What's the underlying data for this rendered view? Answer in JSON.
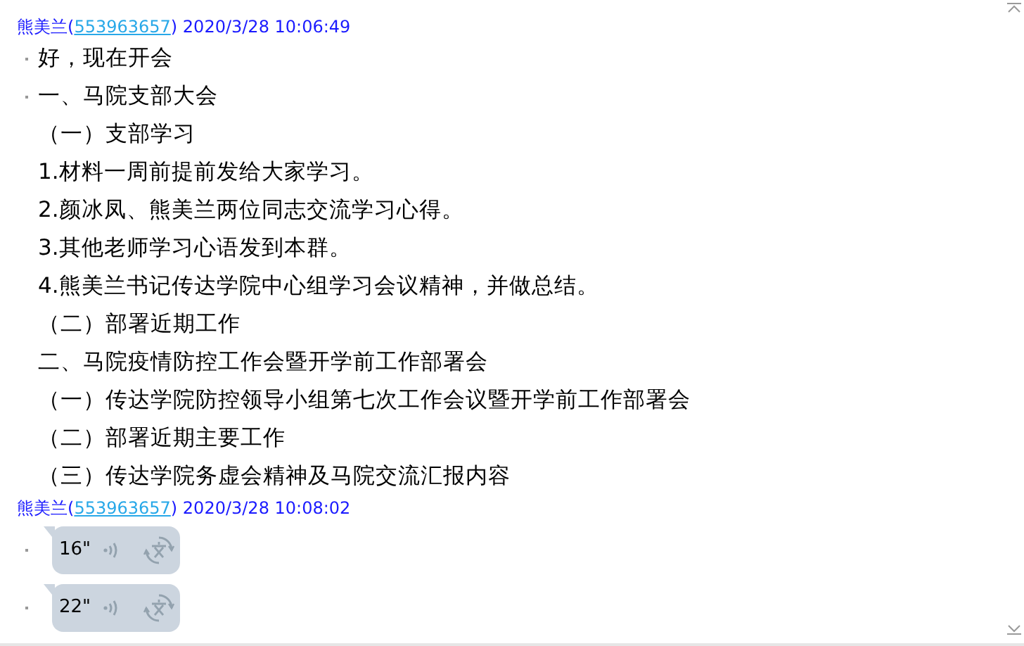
{
  "messages": [
    {
      "sender": "熊美兰",
      "id_open": "(",
      "id": "553963657",
      "id_close": ")",
      "time": "2020/3/28 10:06:49",
      "items": [
        {
          "kind": "text",
          "bullet": true,
          "text": "好，现在开会"
        },
        {
          "kind": "text",
          "bullet": true,
          "text": "一、马院支部大会"
        },
        {
          "kind": "text",
          "bullet": false,
          "text": "（一）支部学习"
        },
        {
          "kind": "text",
          "bullet": false,
          "text": "1.材料一周前提前发给大家学习。"
        },
        {
          "kind": "text",
          "bullet": false,
          "text": "2.颜冰凤、熊美兰两位同志交流学习心得。"
        },
        {
          "kind": "text",
          "bullet": false,
          "text": "3.其他老师学习心语发到本群。"
        },
        {
          "kind": "text",
          "bullet": false,
          "text": "4.熊美兰书记传达学院中心组学习会议精神，并做总结。"
        },
        {
          "kind": "text",
          "bullet": false,
          "text": "（二）部署近期工作"
        },
        {
          "kind": "text",
          "bullet": false,
          "text": "二、马院疫情防控工作会暨开学前工作部署会"
        },
        {
          "kind": "text",
          "bullet": false,
          "text": "（一）传达学院防控领导小组第七次工作会议暨开学前工作部署会"
        },
        {
          "kind": "text",
          "bullet": false,
          "text": "（二）部署近期主要工作"
        },
        {
          "kind": "text",
          "bullet": false,
          "text": "（三）传达学院务虚会精神及马院交流汇报内容"
        }
      ]
    },
    {
      "sender": "熊美兰",
      "id_open": "(",
      "id": "553963657",
      "id_close": ")",
      "time": "2020/3/28 10:08:02",
      "items": [
        {
          "kind": "voice",
          "bullet": true,
          "text": "16\""
        },
        {
          "kind": "voice",
          "bullet": true,
          "text": "22\""
        }
      ]
    }
  ]
}
